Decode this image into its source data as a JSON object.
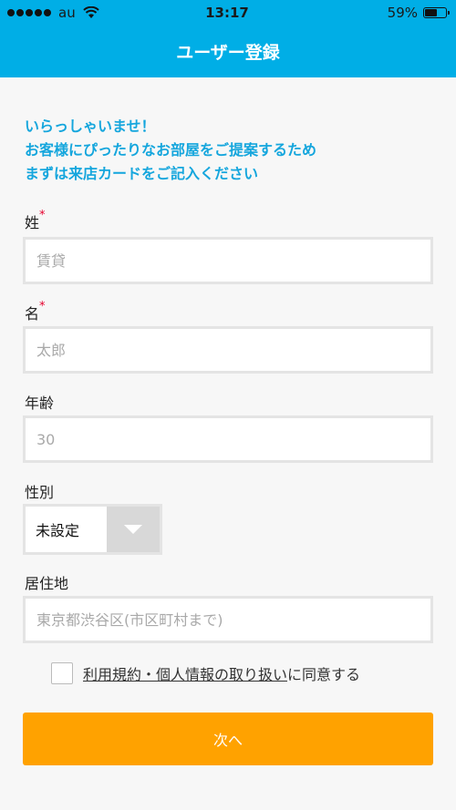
{
  "statusbar": {
    "carrier": "au",
    "time": "13:17",
    "battery": "59%",
    "battery_level": 0.59,
    "signal_bars": 5,
    "signal_filled": 5
  },
  "nav": {
    "title": "ユーザー登録"
  },
  "intro": {
    "line1": "いらっしゃいませ！",
    "line2": "お客様にぴったりなお部屋をご提案するため",
    "line3": "まずは来店カードをご記入ください"
  },
  "form": {
    "last_name": {
      "label": "姓",
      "required_mark": "*",
      "placeholder": "賃貸",
      "value": ""
    },
    "first_name": {
      "label": "名",
      "required_mark": "*",
      "placeholder": "太郎",
      "value": ""
    },
    "age": {
      "label": "年齢",
      "placeholder": "30",
      "value": ""
    },
    "gender": {
      "label": "性別",
      "selected": "未設定"
    },
    "residence": {
      "label": "居住地",
      "placeholder": "東京都渋谷区(市区町村まで)",
      "value": ""
    }
  },
  "agreement": {
    "link_text": "利用規約・個人情報の取り扱い",
    "suffix": "に同意する",
    "checked": false
  },
  "next_button": {
    "label": "次へ"
  },
  "colors": {
    "header": "#00aee6",
    "intro_text": "#15a6dd",
    "required": "#e5002d",
    "button": "#ffa200"
  }
}
